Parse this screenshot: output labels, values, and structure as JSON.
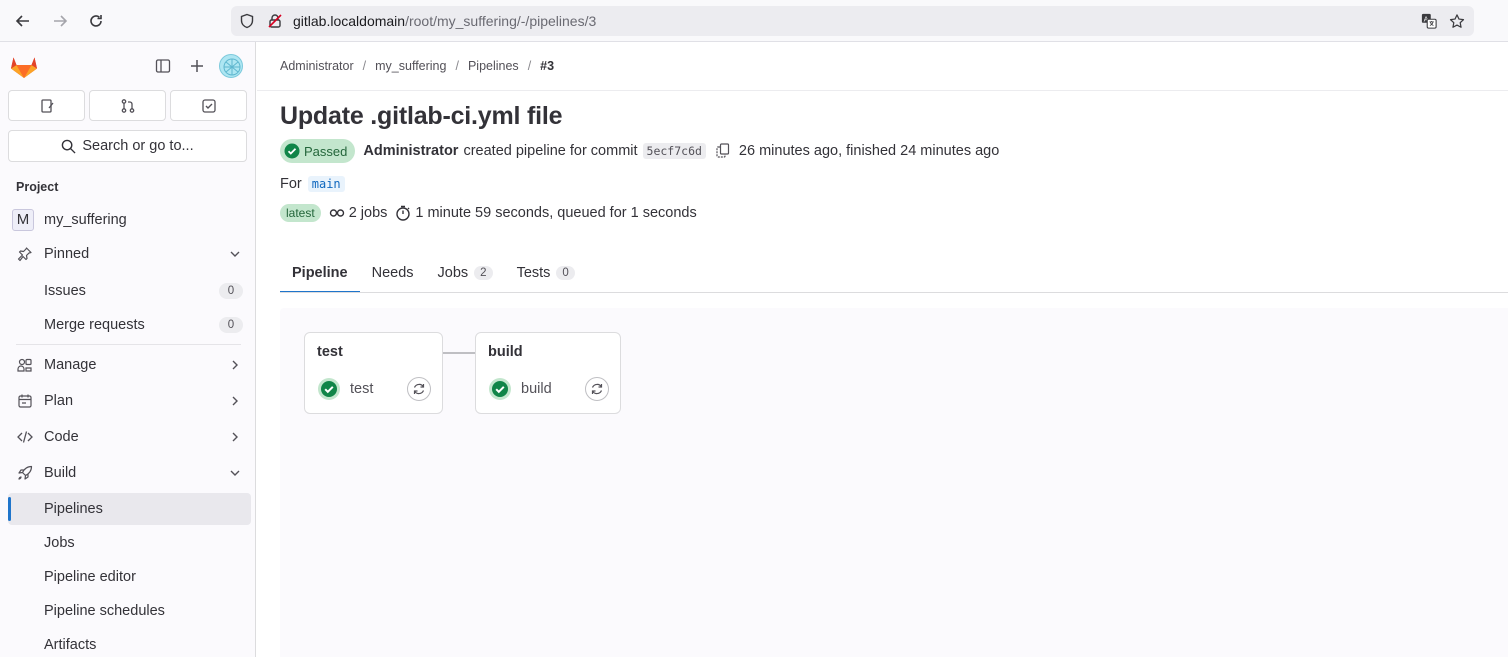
{
  "browser": {
    "url_host": "gitlab.localdomain",
    "url_path": "/root/my_suffering/-/pipelines/3"
  },
  "sidebar": {
    "search_label": "Search or go to...",
    "section_title": "Project",
    "project_initial": "M",
    "project_name": "my_suffering",
    "pinned": "Pinned",
    "issues": {
      "label": "Issues",
      "count": "0"
    },
    "merge_requests": {
      "label": "Merge requests",
      "count": "0"
    },
    "manage": "Manage",
    "plan": "Plan",
    "code": "Code",
    "build": "Build",
    "pipelines": "Pipelines",
    "jobs": "Jobs",
    "pipeline_editor": "Pipeline editor",
    "pipeline_schedules": "Pipeline schedules",
    "artifacts": "Artifacts"
  },
  "breadcrumb": [
    "Administrator",
    "my_suffering",
    "Pipelines",
    "#3"
  ],
  "pipeline": {
    "title": "Update .gitlab-ci.yml file",
    "status": "Passed",
    "author": "Administrator",
    "created_text": "created pipeline for commit",
    "sha": "5ecf7c6d",
    "time_text": "26 minutes ago, finished 24 minutes ago",
    "for_label": "For",
    "branch": "main",
    "latest_badge": "latest",
    "jobs_text": "2 jobs",
    "duration_text": "1 minute 59 seconds, queued for 1 seconds"
  },
  "tabs": [
    {
      "label": "Pipeline"
    },
    {
      "label": "Needs"
    },
    {
      "label": "Jobs",
      "count": "2"
    },
    {
      "label": "Tests",
      "count": "0"
    }
  ],
  "stages": [
    {
      "title": "test",
      "job": "test"
    },
    {
      "title": "build",
      "job": "build"
    }
  ],
  "colors": {
    "success": "#108548",
    "accent": "#1f75cb",
    "badge_green_bg": "#c3e6cd"
  }
}
